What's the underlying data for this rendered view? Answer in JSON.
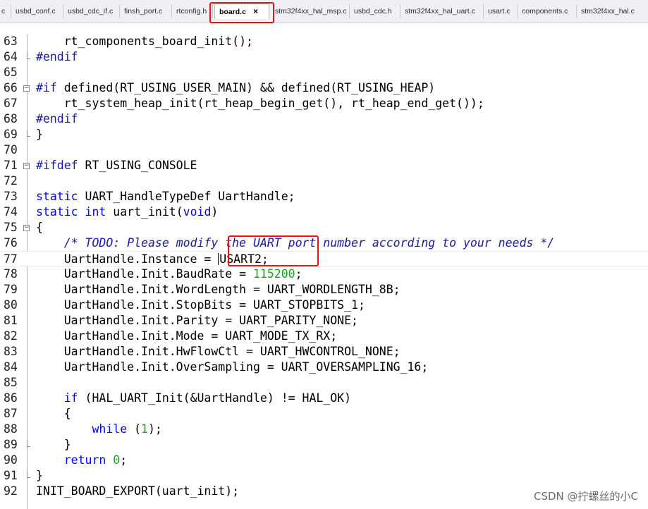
{
  "tabs": [
    {
      "label": "c",
      "active": false
    },
    {
      "label": "usbd_conf.c",
      "active": false
    },
    {
      "label": "usbd_cdc_if.c",
      "active": false
    },
    {
      "label": "finsh_port.c",
      "active": false
    },
    {
      "label": "rtconfig.h",
      "active": false
    },
    {
      "label": "board.c",
      "active": true,
      "close": "×"
    },
    {
      "label": "stm32f4xx_hal_msp.c",
      "active": false
    },
    {
      "label": "usbd_cdc.h",
      "active": false
    },
    {
      "label": "stm32f4xx_hal_uart.c",
      "active": false
    },
    {
      "label": "usart.c",
      "active": false
    },
    {
      "label": "components.c",
      "active": false
    },
    {
      "label": "stm32f4xx_hal.c",
      "active": false
    }
  ],
  "editor": {
    "lines": [
      {
        "n": "63",
        "tokens": [
          [
            "    rt_components_board_init();",
            "txt"
          ]
        ]
      },
      {
        "n": "64",
        "tokens": [
          [
            "#endif",
            "pp"
          ]
        ]
      },
      {
        "n": "65",
        "tokens": []
      },
      {
        "n": "66",
        "tokens": [
          [
            "#if",
            "pp"
          ],
          [
            " defined(RT_USING_USER_MAIN) && defined(RT_USING_HEAP)",
            "txt"
          ]
        ]
      },
      {
        "n": "67",
        "tokens": [
          [
            "    rt_system_heap_init(rt_heap_begin_get(), rt_heap_end_get());",
            "txt"
          ]
        ]
      },
      {
        "n": "68",
        "tokens": [
          [
            "#endif",
            "pp"
          ]
        ]
      },
      {
        "n": "69",
        "tokens": [
          [
            "}",
            "txt"
          ]
        ]
      },
      {
        "n": "70",
        "tokens": []
      },
      {
        "n": "71",
        "tokens": [
          [
            "#ifdef",
            "pp"
          ],
          [
            " RT_USING_CONSOLE",
            "txt"
          ]
        ]
      },
      {
        "n": "72",
        "tokens": []
      },
      {
        "n": "73",
        "tokens": [
          [
            "static",
            "kw"
          ],
          [
            " UART_HandleTypeDef UartHandle;",
            "txt"
          ]
        ]
      },
      {
        "n": "74",
        "tokens": [
          [
            "static",
            "kw"
          ],
          [
            " ",
            "txt"
          ],
          [
            "int",
            "kw"
          ],
          [
            " uart_init(",
            "txt"
          ],
          [
            "void",
            "kw"
          ],
          [
            ")",
            "txt"
          ]
        ]
      },
      {
        "n": "75",
        "tokens": [
          [
            "{",
            "txt"
          ]
        ]
      },
      {
        "n": "76",
        "tokens": [
          [
            "    ",
            "txt"
          ],
          [
            "/* TODO: Please modify the UART port number according to your needs */",
            "cm"
          ]
        ]
      },
      {
        "n": "77",
        "tokens": [
          [
            "    UartHandle.Instance = ",
            "txt"
          ],
          [
            "",
            "caret"
          ],
          [
            "USART2;",
            "txt"
          ]
        ]
      },
      {
        "n": "78",
        "tokens": [
          [
            "    UartHandle.Init.BaudRate = ",
            "txt"
          ],
          [
            "115200",
            "num"
          ],
          [
            ";",
            "txt"
          ]
        ]
      },
      {
        "n": "79",
        "tokens": [
          [
            "    UartHandle.Init.WordLength = UART_WORDLENGTH_8B;",
            "txt"
          ]
        ]
      },
      {
        "n": "80",
        "tokens": [
          [
            "    UartHandle.Init.StopBits = UART_STOPBITS_1;",
            "txt"
          ]
        ]
      },
      {
        "n": "81",
        "tokens": [
          [
            "    UartHandle.Init.Parity = UART_PARITY_NONE;",
            "txt"
          ]
        ]
      },
      {
        "n": "82",
        "tokens": [
          [
            "    UartHandle.Init.Mode = UART_MODE_TX_RX;",
            "txt"
          ]
        ]
      },
      {
        "n": "83",
        "tokens": [
          [
            "    UartHandle.Init.HwFlowCtl = UART_HWCONTROL_NONE;",
            "txt"
          ]
        ]
      },
      {
        "n": "84",
        "tokens": [
          [
            "    UartHandle.Init.OverSampling = UART_OVERSAMPLING_16;",
            "txt"
          ]
        ]
      },
      {
        "n": "85",
        "tokens": []
      },
      {
        "n": "86",
        "tokens": [
          [
            "    ",
            "txt"
          ],
          [
            "if",
            "kw"
          ],
          [
            " (HAL_UART_Init(&UartHandle) != HAL_OK)",
            "txt"
          ]
        ]
      },
      {
        "n": "87",
        "tokens": [
          [
            "    {",
            "txt"
          ]
        ]
      },
      {
        "n": "88",
        "tokens": [
          [
            "        ",
            "txt"
          ],
          [
            "while",
            "kw"
          ],
          [
            " (",
            "txt"
          ],
          [
            "1",
            "num"
          ],
          [
            ");",
            "txt"
          ]
        ]
      },
      {
        "n": "89",
        "tokens": [
          [
            "    }",
            "txt"
          ]
        ]
      },
      {
        "n": "90",
        "tokens": [
          [
            "    ",
            "txt"
          ],
          [
            "return",
            "kw"
          ],
          [
            " ",
            "txt"
          ],
          [
            "0",
            "num"
          ],
          [
            ";",
            "txt"
          ]
        ]
      },
      {
        "n": "91",
        "tokens": [
          [
            "}",
            "txt"
          ]
        ]
      },
      {
        "n": "92",
        "tokens": [
          [
            "INIT_BOARD_EXPORT(uart_init);",
            "txt"
          ]
        ]
      }
    ]
  },
  "watermark": "CSDN @拧螺丝的小C",
  "colors": {
    "keyword": "#0000ff",
    "number": "#1e9e1e",
    "comment": "#1a1aa6",
    "highlight_box": "#ee1111"
  }
}
